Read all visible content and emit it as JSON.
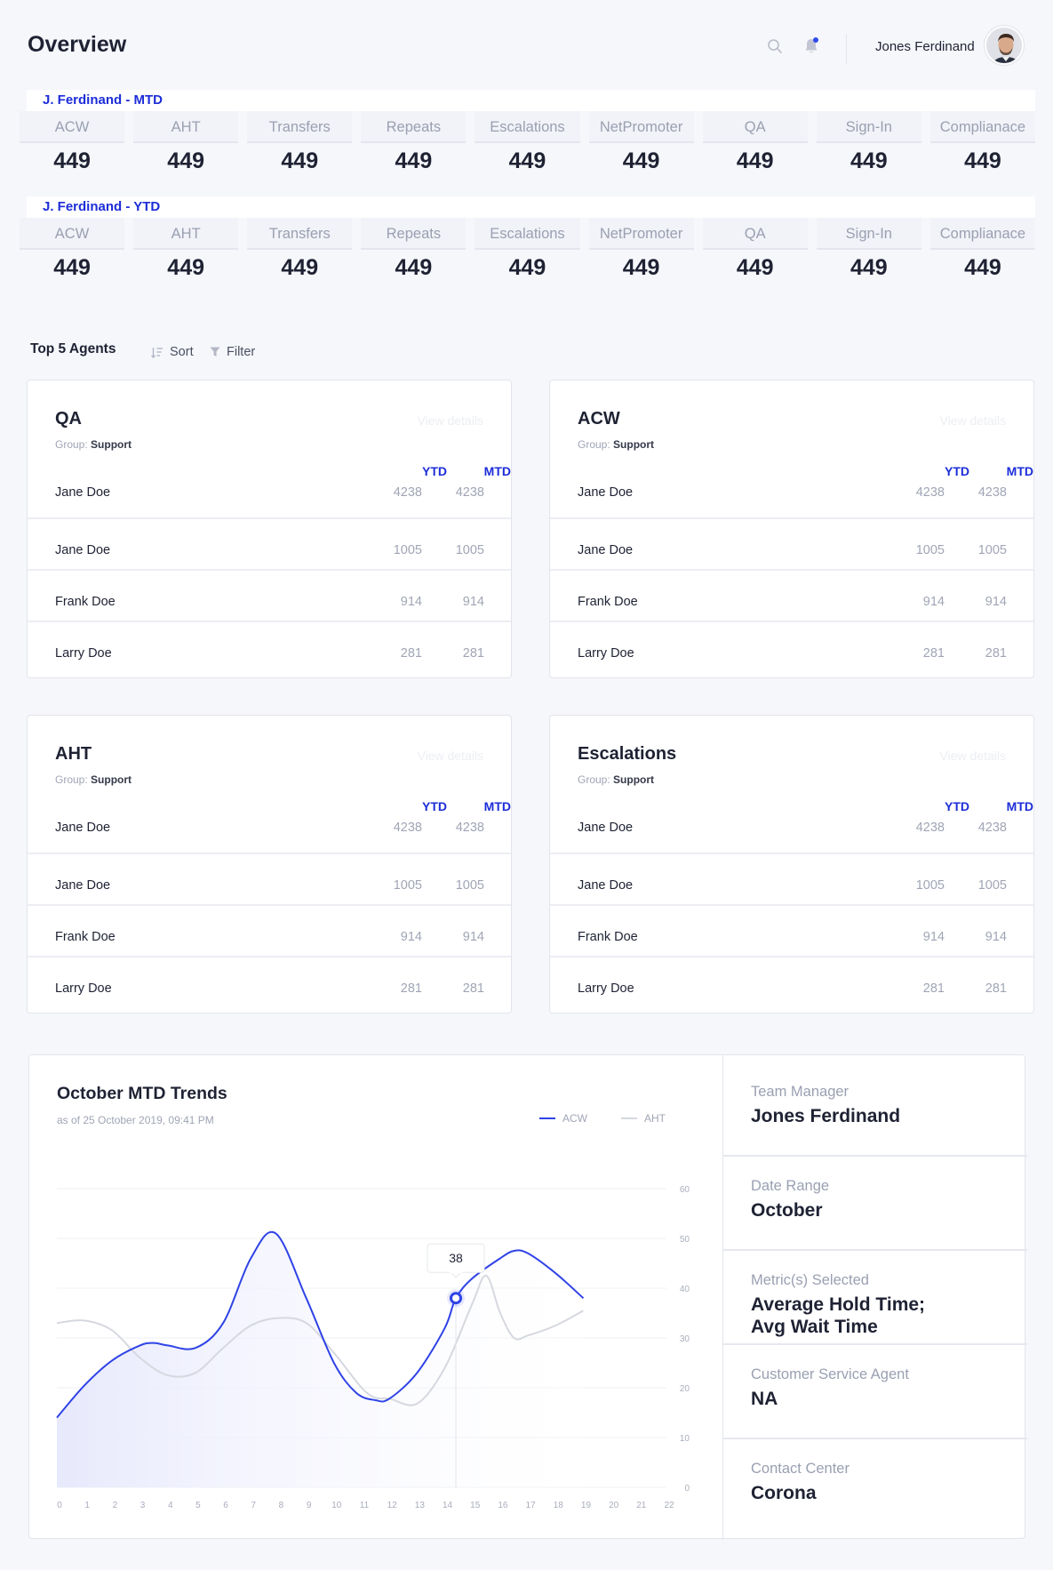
{
  "header": {
    "title": "Overview",
    "user_name": "Jones Ferdinand"
  },
  "stats": [
    {
      "label": "J. Ferdinand - MTD",
      "metrics": [
        {
          "name": "ACW",
          "value": "449"
        },
        {
          "name": "AHT",
          "value": "449"
        },
        {
          "name": "Transfers",
          "value": "449"
        },
        {
          "name": "Repeats",
          "value": "449"
        },
        {
          "name": "Escalations",
          "value": "449"
        },
        {
          "name": "NetPromoter",
          "value": "449"
        },
        {
          "name": "QA",
          "value": "449"
        },
        {
          "name": "Sign-In",
          "value": "449"
        },
        {
          "name": "Complianace",
          "value": "449"
        }
      ]
    },
    {
      "label": "J. Ferdinand - YTD",
      "metrics": [
        {
          "name": "ACW",
          "value": "449"
        },
        {
          "name": "AHT",
          "value": "449"
        },
        {
          "name": "Transfers",
          "value": "449"
        },
        {
          "name": "Repeats",
          "value": "449"
        },
        {
          "name": "Escalations",
          "value": "449"
        },
        {
          "name": "NetPromoter",
          "value": "449"
        },
        {
          "name": "QA",
          "value": "449"
        },
        {
          "name": "Sign-In",
          "value": "449"
        },
        {
          "name": "Complianace",
          "value": "449"
        }
      ]
    }
  ],
  "toolbar": {
    "title": "Top 5 Agents",
    "sort_label": "Sort",
    "filter_label": "Filter"
  },
  "agent_cards": [
    {
      "title": "QA",
      "group_label": "Group:",
      "group_value": "Support",
      "view_details": "View details",
      "col_ytd": "YTD",
      "col_mtd": "MTD",
      "rows": [
        {
          "name": "Jane Doe",
          "ytd": "4238",
          "mtd": "4238"
        },
        {
          "name": "Jane Doe",
          "ytd": "1005",
          "mtd": "1005"
        },
        {
          "name": "Frank Doe",
          "ytd": "914",
          "mtd": "914"
        },
        {
          "name": "Larry Doe",
          "ytd": "281",
          "mtd": "281"
        }
      ]
    },
    {
      "title": "ACW",
      "group_label": "Group:",
      "group_value": "Support",
      "view_details": "View details",
      "col_ytd": "YTD",
      "col_mtd": "MTD",
      "rows": [
        {
          "name": "Jane Doe",
          "ytd": "4238",
          "mtd": "4238"
        },
        {
          "name": "Jane Doe",
          "ytd": "1005",
          "mtd": "1005"
        },
        {
          "name": "Frank Doe",
          "ytd": "914",
          "mtd": "914"
        },
        {
          "name": "Larry Doe",
          "ytd": "281",
          "mtd": "281"
        }
      ]
    },
    {
      "title": "AHT",
      "group_label": "Group:",
      "group_value": "Support",
      "view_details": "View details",
      "col_ytd": "YTD",
      "col_mtd": "MTD",
      "rows": [
        {
          "name": "Jane Doe",
          "ytd": "4238",
          "mtd": "4238"
        },
        {
          "name": "Jane Doe",
          "ytd": "1005",
          "mtd": "1005"
        },
        {
          "name": "Frank Doe",
          "ytd": "914",
          "mtd": "914"
        },
        {
          "name": "Larry Doe",
          "ytd": "281",
          "mtd": "281"
        }
      ]
    },
    {
      "title": "Escalations",
      "group_label": "Group:",
      "group_value": "Support",
      "view_details": "View details",
      "col_ytd": "YTD",
      "col_mtd": "MTD",
      "rows": [
        {
          "name": "Jane Doe",
          "ytd": "4238",
          "mtd": "4238"
        },
        {
          "name": "Jane Doe",
          "ytd": "1005",
          "mtd": "1005"
        },
        {
          "name": "Frank Doe",
          "ytd": "914",
          "mtd": "914"
        },
        {
          "name": "Larry Doe",
          "ytd": "281",
          "mtd": "281"
        }
      ]
    }
  ],
  "trends": {
    "title": "October MTD Trends",
    "subtitle": "as of 25 October 2019, 09:41 PM",
    "tooltip_value": "38"
  },
  "chart_data": {
    "type": "line",
    "title": "October MTD Trends",
    "x": [
      0,
      1,
      2,
      3,
      4,
      5,
      6,
      7,
      8,
      9,
      10,
      11,
      12,
      13,
      14,
      15,
      16,
      17,
      18,
      19,
      20,
      21,
      22
    ],
    "ylim": [
      0,
      60
    ],
    "y_ticks": [
      0,
      10,
      20,
      30,
      40,
      50,
      60
    ],
    "series": [
      {
        "name": "ACW",
        "color": "#2f43e6",
        "area": true,
        "points": [
          [
            0,
            14
          ],
          [
            1,
            20.5
          ],
          [
            2,
            25.5
          ],
          [
            3,
            28.5
          ],
          [
            3.5,
            29
          ],
          [
            4,
            28.5
          ],
          [
            5,
            28
          ],
          [
            6,
            33
          ],
          [
            7,
            46
          ],
          [
            7.9,
            51
          ],
          [
            9,
            38
          ],
          [
            10,
            25
          ],
          [
            10.8,
            19
          ],
          [
            11.5,
            17.5
          ],
          [
            12,
            17.8
          ],
          [
            13,
            23
          ],
          [
            14,
            32
          ],
          [
            14.4,
            38
          ],
          [
            15,
            42
          ],
          [
            16,
            46
          ],
          [
            16.5,
            47.5
          ],
          [
            17,
            47
          ],
          [
            18,
            43
          ],
          [
            19,
            38
          ]
        ]
      },
      {
        "name": "AHT",
        "color": "#d6d8e0",
        "points": [
          [
            0,
            33
          ],
          [
            1,
            33.5
          ],
          [
            2,
            31.5
          ],
          [
            3,
            26
          ],
          [
            4,
            22.5
          ],
          [
            5,
            23
          ],
          [
            6,
            28
          ],
          [
            7,
            32.5
          ],
          [
            8,
            34
          ],
          [
            9,
            33
          ],
          [
            10,
            27
          ],
          [
            11,
            20
          ],
          [
            11.5,
            18
          ],
          [
            12,
            17.8
          ],
          [
            13,
            16.8
          ],
          [
            14,
            24
          ],
          [
            15,
            37
          ],
          [
            15.5,
            42.5
          ],
          [
            16,
            35
          ],
          [
            16.5,
            30
          ],
          [
            17,
            30.5
          ],
          [
            18,
            32.5
          ],
          [
            19,
            35.5
          ]
        ]
      }
    ],
    "highlight": {
      "x": 14.4,
      "y": 38,
      "label": "38"
    }
  },
  "info_panel": [
    {
      "label": "Team Manager",
      "value": "Jones Ferdinand"
    },
    {
      "label": "Date Range",
      "value": "October"
    },
    {
      "label": "Metric(s) Selected",
      "value_lines": [
        "Average Hold Time;",
        "Avg Wait Time"
      ]
    },
    {
      "label": "Customer Service Agent",
      "value": "NA"
    },
    {
      "label": "Contact Center",
      "value": "Corona"
    }
  ],
  "colors": {
    "accent": "#1c2dd8",
    "line_primary": "#2f43e6",
    "line_secondary": "#d6d8e0",
    "muted_text": "#a0a5b5"
  }
}
